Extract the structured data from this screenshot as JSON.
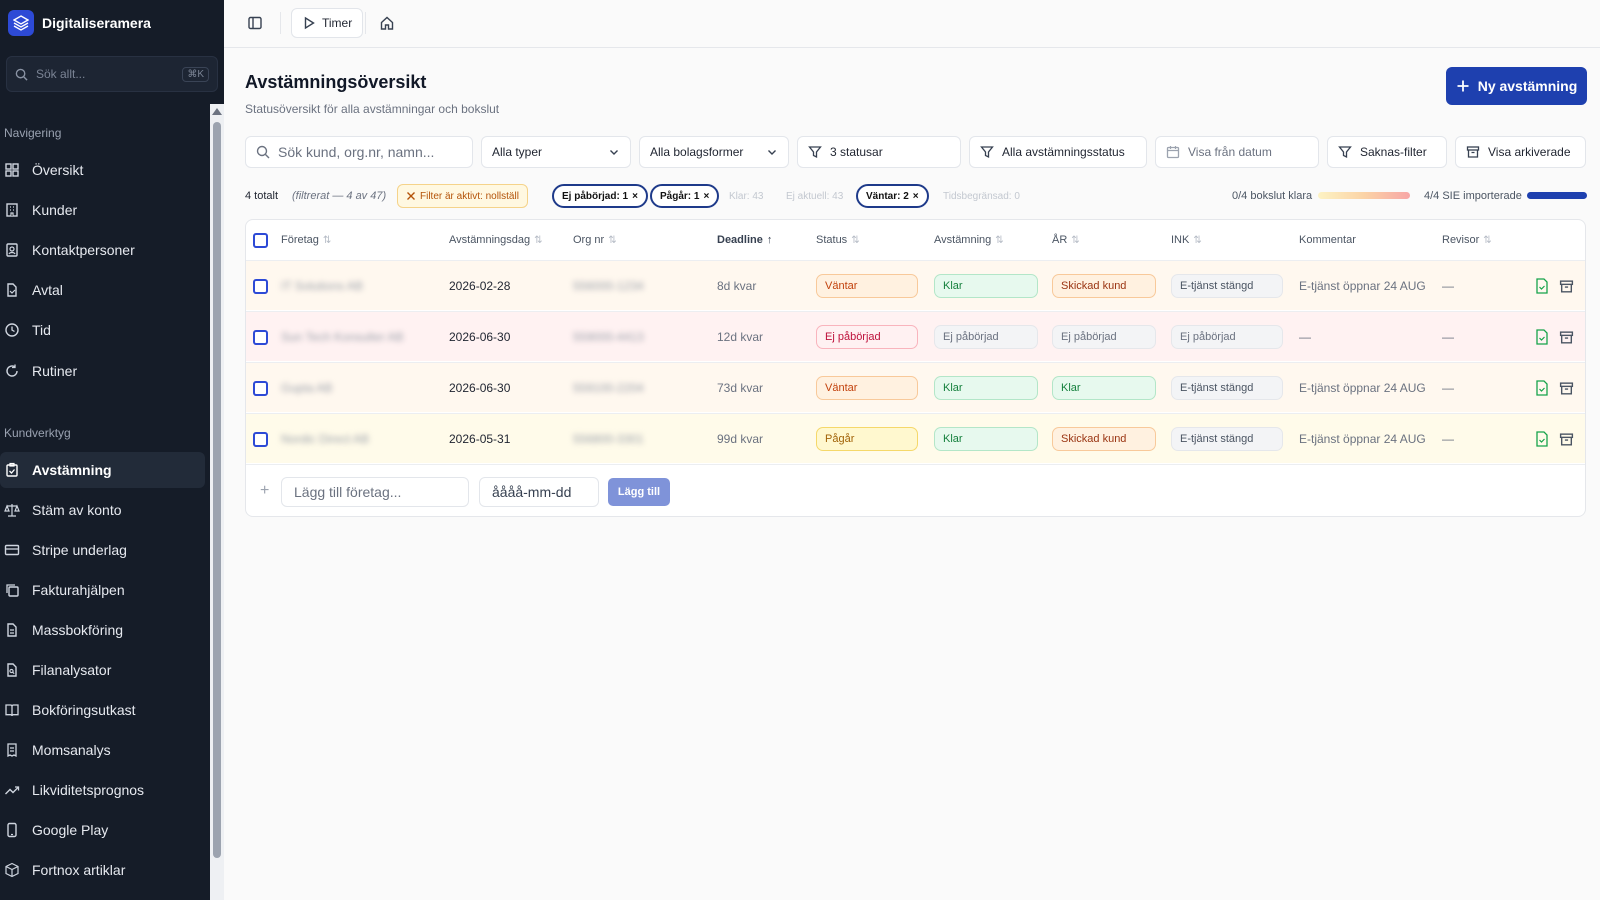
{
  "app": {
    "name": "Digitaliseramera"
  },
  "sidebar": {
    "search_placeholder": "Sök allt...",
    "search_shortcut": "⌘K",
    "section_nav": "Navigering",
    "section_tools": "Kundverktyg",
    "nav_items": [
      {
        "label": "Översikt",
        "icon": "grid-icon"
      },
      {
        "label": "Kunder",
        "icon": "building-icon"
      },
      {
        "label": "Kontaktpersoner",
        "icon": "contact-icon"
      },
      {
        "label": "Avtal",
        "icon": "document-icon"
      },
      {
        "label": "Tid",
        "icon": "clock-icon"
      },
      {
        "label": "Rutiner",
        "icon": "refresh-icon"
      }
    ],
    "tool_items": [
      {
        "label": "Avstämning",
        "icon": "clipboard-check-icon",
        "active": true
      },
      {
        "label": "Stäm av konto",
        "icon": "scale-icon"
      },
      {
        "label": "Stripe underlag",
        "icon": "card-icon"
      },
      {
        "label": "Fakturahjälpen",
        "icon": "copy-icon"
      },
      {
        "label": "Massbokföring",
        "icon": "document-stack-icon"
      },
      {
        "label": "Filanalysator",
        "icon": "file-search-icon"
      },
      {
        "label": "Bokföringsutkast",
        "icon": "book-icon"
      },
      {
        "label": "Momsanalys",
        "icon": "receipt-icon"
      },
      {
        "label": "Likviditetsprognos",
        "icon": "trend-up-icon"
      },
      {
        "label": "Google Play",
        "icon": "phone-icon"
      },
      {
        "label": "Fortnox artiklar",
        "icon": "package-icon"
      }
    ]
  },
  "topbar": {
    "timer_label": "Timer"
  },
  "header": {
    "title": "Avstämningsöversikt",
    "subtitle": "Statusöversikt för alla avstämningar och bokslut",
    "new_button": "Ny avstämning"
  },
  "filters": {
    "search_placeholder": "Sök kund, org.nr, namn...",
    "types": "Alla typer",
    "company_forms": "Alla bolagsformer",
    "statuses": "3 statusar",
    "reconciliation_status": "Alla avstämningsstatus",
    "from_date": "Visa från datum",
    "missing_filter": "Saknas-filter",
    "show_archived": "Visa arkiverade"
  },
  "summary": {
    "total": "4 totalt",
    "filtered": "(filtrerat — 4 av 47)",
    "reset": "Filter är aktivt: nollställ",
    "chip_notstarted": "Ej påbörjad: 1",
    "chip_ongoing": "Pågår: 1",
    "chip_klar": "Klar: 43",
    "chip_ejaktuell": "Ej aktuell: 43",
    "chip_waiting": "Väntar: 2",
    "chip_timelimited": "Tidsbegränsad: 0",
    "bokslut_ready": "0/4 bokslut klara",
    "sie_imported": "4/4 SIE importerade",
    "sie_fraction": 1.0,
    "colors": {
      "accent": "#1e40af",
      "progress_sie": "#1e40af"
    }
  },
  "table": {
    "headers": {
      "company": "Företag",
      "date": "Avstämningsdag",
      "org": "Org nr",
      "deadline": "Deadline",
      "status": "Status",
      "reconciliation": "Avstämning",
      "ar": "ÅR",
      "ink": "INK",
      "comment": "Kommentar",
      "auditor": "Revisor"
    },
    "rows": [
      {
        "company": "IT Solutions AB",
        "date": "2026-02-28",
        "org": "556000-1234",
        "deadline": "8d kvar",
        "status": "Väntar",
        "reconciliation": "Klar",
        "ar": "Skickad kund",
        "ink": "E-tjänst stängd",
        "comment": "E-tjänst öppnar 24 AUG",
        "auditor": "—",
        "bg": "#fff8ef"
      },
      {
        "company": "Sun Tech Konsulter AB",
        "date": "2026-06-30",
        "org": "559000-4413",
        "deadline": "12d kvar",
        "status": "Ej påbörjad",
        "reconciliation": "Ej påbörjad",
        "ar": "Ej påbörjad",
        "ink": "Ej påbörjad",
        "comment": "—",
        "auditor": "—",
        "bg": "#fff2f2"
      },
      {
        "company": "Gupta AB",
        "date": "2026-06-30",
        "org": "559100-2204",
        "deadline": "73d kvar",
        "status": "Väntar",
        "reconciliation": "Klar",
        "ar": "Klar",
        "ink": "E-tjänst stängd",
        "comment": "E-tjänst öppnar 24 AUG",
        "auditor": "—",
        "bg": "#fff8ef"
      },
      {
        "company": "Nordic Direct AB",
        "date": "2026-05-31",
        "org": "556800-3301",
        "deadline": "99d kvar",
        "status": "Pågår",
        "reconciliation": "Klar",
        "ar": "Skickad kund",
        "ink": "E-tjänst stängd",
        "comment": "E-tjänst öppnar 24 AUG",
        "auditor": "—",
        "bg": "#fffbea"
      }
    ],
    "add_company_placeholder": "Lägg till företag...",
    "add_date_placeholder": "åååå-mm-dd",
    "add_button": "Lägg till"
  }
}
